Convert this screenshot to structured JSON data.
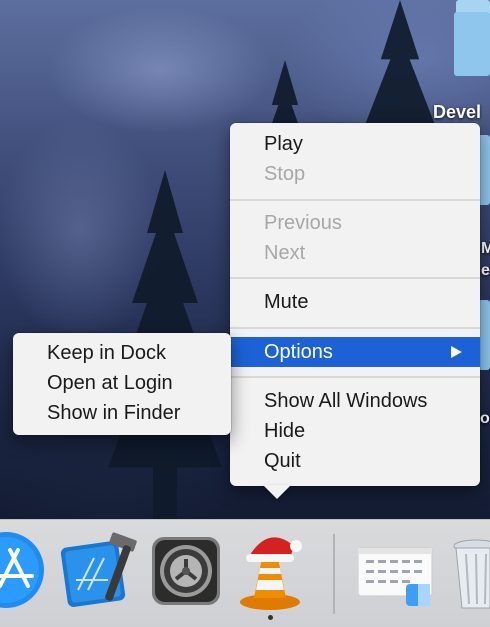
{
  "desktop": {
    "labels": [
      "Devel",
      "M",
      "e",
      "o"
    ]
  },
  "context_menu": {
    "items": [
      {
        "label": "Play",
        "enabled": true
      },
      {
        "label": "Stop",
        "enabled": false
      },
      {
        "label": "Previous",
        "enabled": false
      },
      {
        "label": "Next",
        "enabled": false
      },
      {
        "label": "Mute",
        "enabled": true
      },
      {
        "label": "Options",
        "enabled": true,
        "selected": true,
        "has_submenu": true
      },
      {
        "label": "Show All Windows",
        "enabled": true
      },
      {
        "label": "Hide",
        "enabled": true
      },
      {
        "label": "Quit",
        "enabled": true
      }
    ]
  },
  "options_submenu": {
    "items": [
      {
        "label": "Keep in Dock"
      },
      {
        "label": "Open at Login"
      },
      {
        "label": "Show in Finder"
      }
    ]
  },
  "dock": {
    "apps": [
      {
        "name": "App Store",
        "icon": "app-store-icon"
      },
      {
        "name": "Xcode",
        "icon": "xcode-icon"
      },
      {
        "name": "System Preferences",
        "icon": "system-preferences-icon"
      },
      {
        "name": "VLC",
        "icon": "vlc-cone-icon",
        "running": true
      },
      {
        "name": "Finder window preview",
        "icon": "finder-window-icon"
      },
      {
        "name": "Trash",
        "icon": "trash-icon"
      }
    ]
  },
  "colors": {
    "selection": "#1c62d6",
    "menu_background": "#f2f2f2",
    "disabled_text": "#a7a7a7",
    "dock": "#d9dadc"
  }
}
